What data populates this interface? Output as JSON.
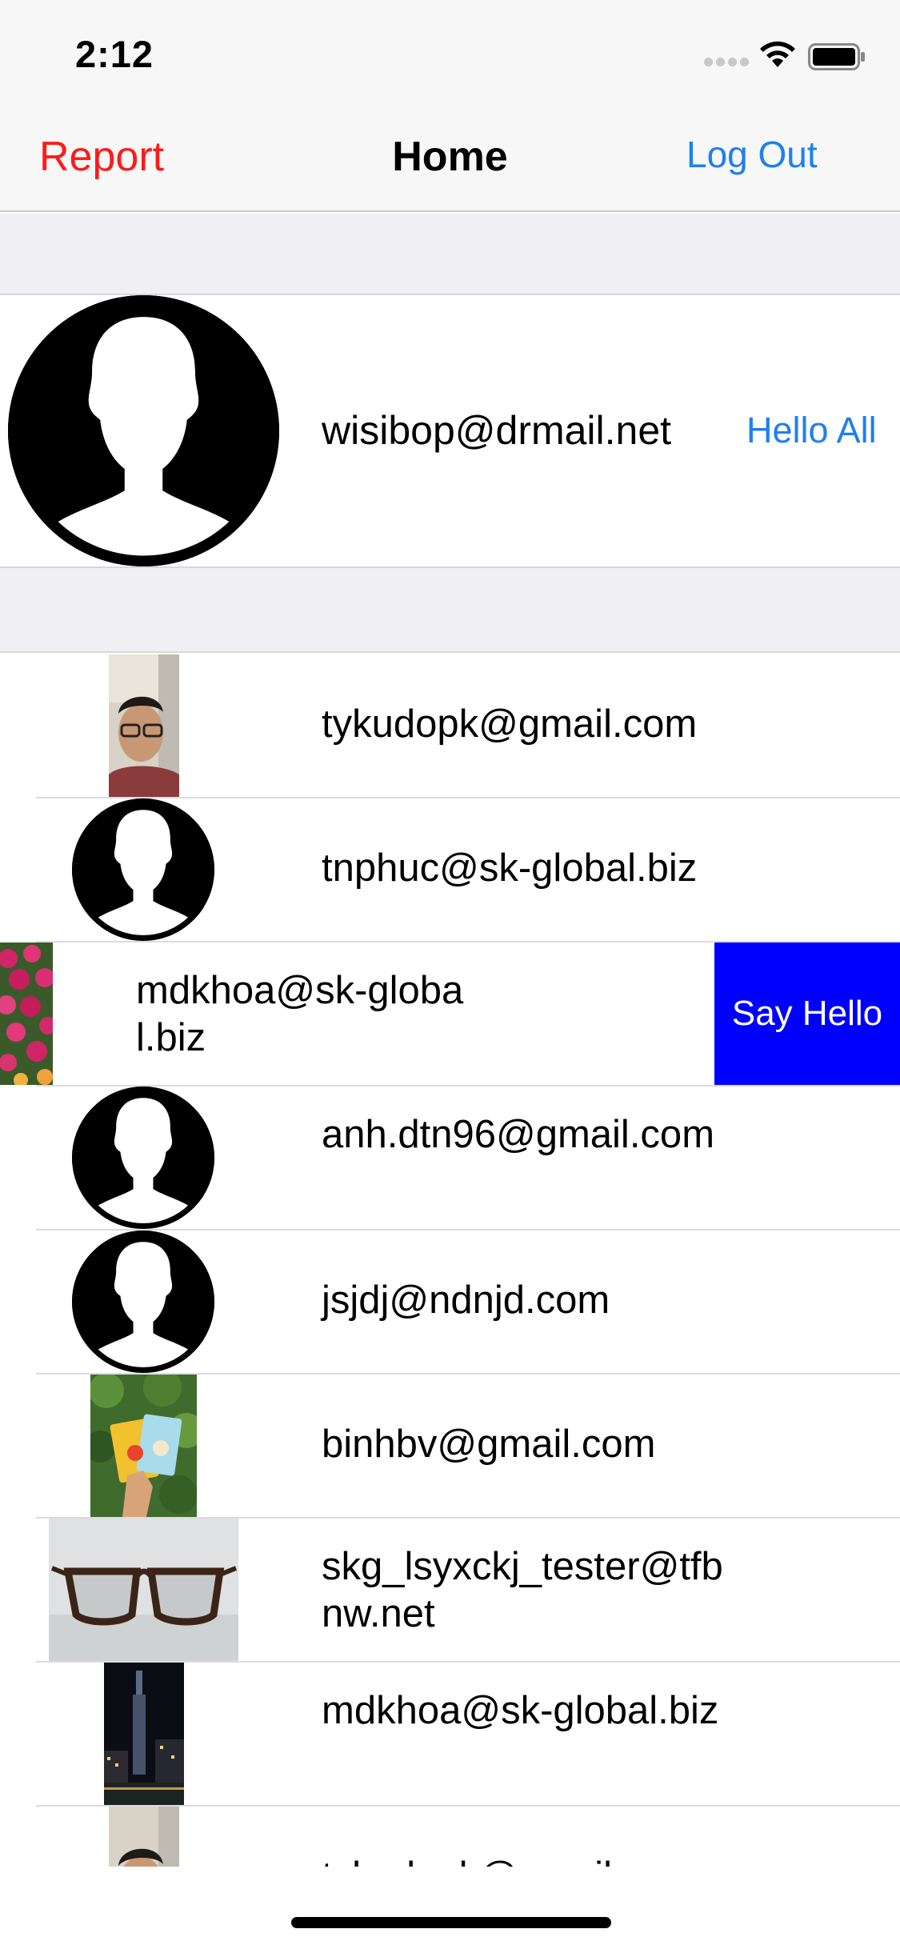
{
  "status_bar": {
    "time": "2:12"
  },
  "nav": {
    "left_label": "Report",
    "title": "Home",
    "right_label": "Log Out"
  },
  "current_user": {
    "email": "wisibop@drmail.net",
    "action_label": "Hello All",
    "avatar_icon": "person-silhouette-icon"
  },
  "contacts": [
    {
      "email": "tykudopk@gmail.com",
      "avatar": "photo-man-glasses"
    },
    {
      "email": "tnphuc@sk-global.biz",
      "avatar": "person-silhouette-icon"
    },
    {
      "email": "mdkhoa@sk-global.biz",
      "avatar": "photo-flowers",
      "swiped_action": "Say Hello"
    },
    {
      "email": "anh.dtn96@gmail.com",
      "avatar": "person-silhouette-icon"
    },
    {
      "email": "jsjdj@ndnjd.com",
      "avatar": "person-silhouette-icon"
    },
    {
      "email": "binhbv@gmail.com",
      "avatar": "photo-snack-packs"
    },
    {
      "email": "skg_lsyxckj_tester@tfbnw.net",
      "avatar": "photo-eyeglasses"
    },
    {
      "email": "mdkhoa@sk-global.biz",
      "avatar": "photo-night-city"
    },
    {
      "email": "tykudopk@gmail.com",
      "avatar": "photo-man-glasses"
    }
  ],
  "colors": {
    "destructive": "#ff1a1a",
    "tint": "#1e7ff0",
    "swipe_action_bg": "#0000ff",
    "background_group": "#efeff4"
  }
}
